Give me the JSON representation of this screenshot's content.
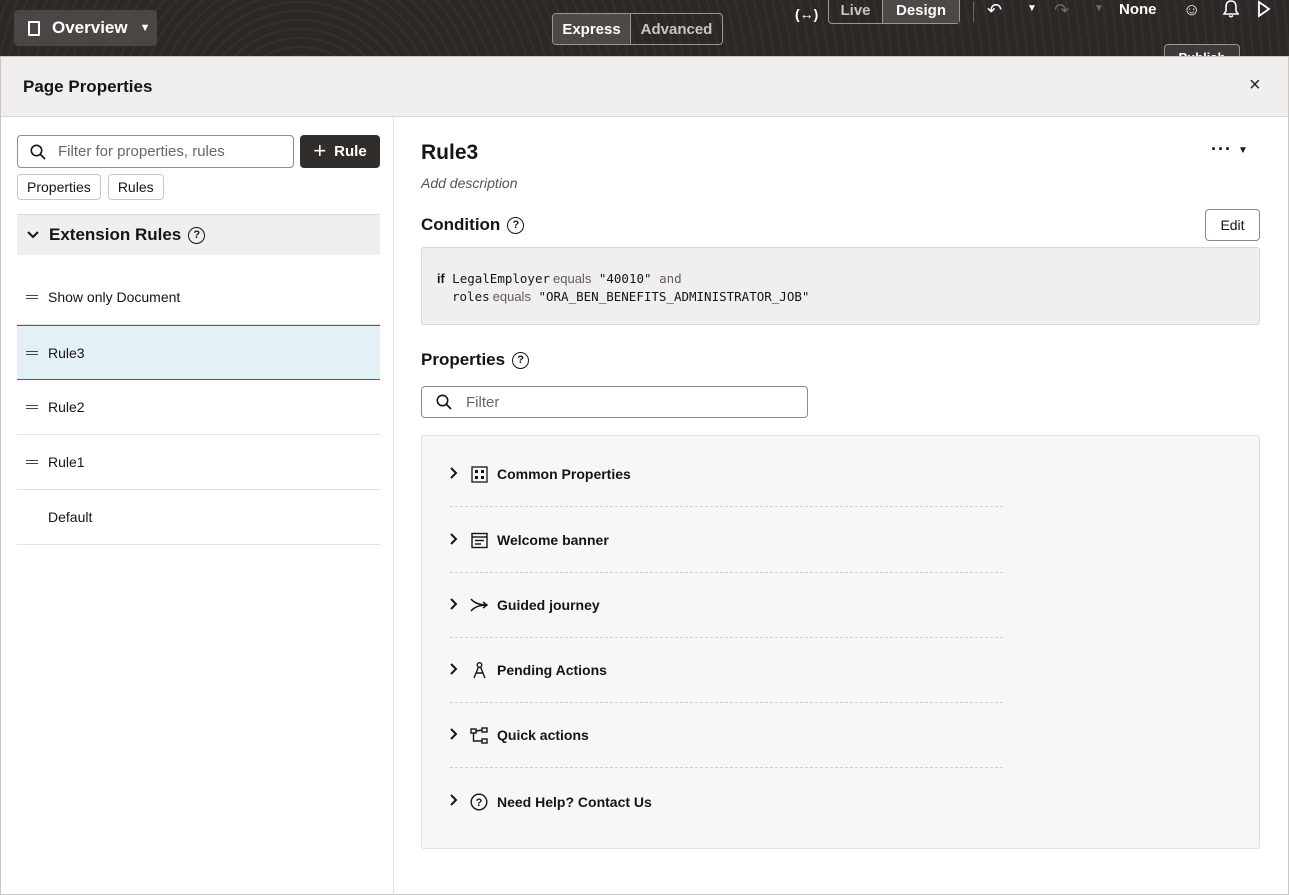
{
  "topbar": {
    "overview_label": "Overview",
    "express_label": "Express",
    "advanced_label": "Advanced",
    "live_label": "Live",
    "design_label": "Design",
    "none_label": "None",
    "publish_label": "Publish"
  },
  "dialog": {
    "title": "Page Properties",
    "close_glyph": "×"
  },
  "left": {
    "search_placeholder": "Filter for properties, rules",
    "rule_button_label": "Rule",
    "chips": [
      "Properties",
      "Rules"
    ],
    "section_title": "Extension Rules",
    "rules": [
      {
        "label": "Show only Document",
        "draggable": true,
        "selected": false
      },
      {
        "label": "Rule3",
        "draggable": true,
        "selected": true
      },
      {
        "label": "Rule2",
        "draggable": true,
        "selected": false
      },
      {
        "label": "Rule1",
        "draggable": true,
        "selected": false
      },
      {
        "label": "Default",
        "draggable": false,
        "selected": false
      }
    ]
  },
  "right": {
    "rule_title": "Rule3",
    "description_placeholder": "Add description",
    "condition_title": "Condition",
    "edit_label": "Edit",
    "condition": {
      "if_kw": "if",
      "field1": "LegalEmployer",
      "op1": "equals",
      "val1": "\"40010\"",
      "conj": "and",
      "field2": "roles",
      "op2": "equals",
      "val2": "\"ORA_BEN_BENEFITS_ADMINISTRATOR_JOB\""
    },
    "properties_title": "Properties",
    "filter_placeholder": "Filter",
    "property_groups": [
      {
        "label": "Common Properties",
        "icon": "grid-icon"
      },
      {
        "label": "Welcome banner",
        "icon": "banner-icon"
      },
      {
        "label": "Guided journey",
        "icon": "journey-icon"
      },
      {
        "label": "Pending Actions",
        "icon": "compass-icon"
      },
      {
        "label": "Quick actions",
        "icon": "flow-icon"
      },
      {
        "label": "Need Help? Contact Us",
        "icon": "help-circle-icon"
      }
    ]
  },
  "colors": {
    "topbar_bg": "#2b2826",
    "primary_btn": "#312d2a",
    "selected_row_bg": "#e3f0f5",
    "selected_row_border": "#2f6c7a"
  }
}
